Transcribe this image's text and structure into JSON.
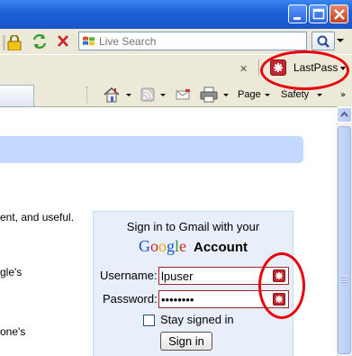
{
  "browser": {
    "search": {
      "placeholder": "Live Search"
    },
    "toolbar_close": "✕",
    "lastpass": {
      "label": "LastPass"
    },
    "commands": {
      "page_label": "Page",
      "safety_label": "Safety",
      "more": "»"
    }
  },
  "page": {
    "left_text": [
      "ent, and useful.",
      "gle's",
      "one's"
    ],
    "login": {
      "title": "Sign in to Gmail with your",
      "google_letters": [
        "G",
        "o",
        "o",
        "g",
        "l",
        "e"
      ],
      "account_word": "Account",
      "username_label": "Username:",
      "username_value": "lpuser",
      "password_label": "Password:",
      "password_value": "lpuserpw",
      "stay_signed_in_label": "Stay signed in",
      "signin_label": "Sign in"
    }
  },
  "colors": {
    "titlebar": "#1d5fd8",
    "chrome": "#ece9d8",
    "banner": "#c3d9ff",
    "login_box": "#e8eefa",
    "lastpass_red": "#c1272d",
    "annotation_red": "#e8000b"
  },
  "icons": [
    "minimize-icon",
    "maximize-icon",
    "close-icon",
    "lock-icon",
    "refresh-icon",
    "stop-icon",
    "windows-logo-icon",
    "search-icon",
    "lastpass-icon",
    "home-icon",
    "feeds-icon",
    "mail-icon",
    "print-icon",
    "scroll-up-icon"
  ]
}
